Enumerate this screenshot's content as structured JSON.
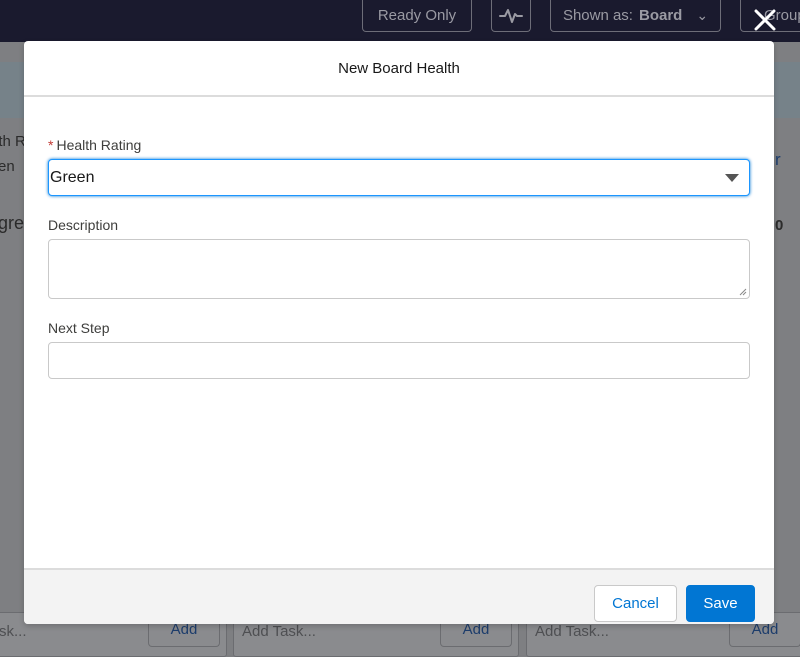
{
  "topbar": {
    "ready_only_label": "Ready Only",
    "pulse_icon": "pulse-icon",
    "shown_as_prefix": "Shown as:",
    "shown_as_value": "Board",
    "group_label": "Group"
  },
  "background": {
    "fragment_1": "lth R",
    "fragment_2": "en",
    "fragment_3": "gre",
    "fragment_4": "r",
    "fragment_5": "0",
    "columns": [
      {
        "placeholder": "sk...",
        "add_label": "Add"
      },
      {
        "placeholder": "Add Task...",
        "add_label": "Add"
      },
      {
        "placeholder": "Add Task...",
        "add_label": "Add"
      }
    ]
  },
  "modal": {
    "title": "New Board Health",
    "close_icon": "close-icon",
    "health_rating": {
      "label": "Health Rating",
      "required_marker": "*",
      "value": "Green"
    },
    "description": {
      "label": "Description",
      "value": ""
    },
    "next_step": {
      "label": "Next Step",
      "value": ""
    },
    "footer": {
      "cancel_label": "Cancel",
      "save_label": "Save"
    }
  },
  "colors": {
    "brand_blue": "#0176d3",
    "required_red": "#c23934",
    "topbar_bg": "#1a1a2e"
  }
}
